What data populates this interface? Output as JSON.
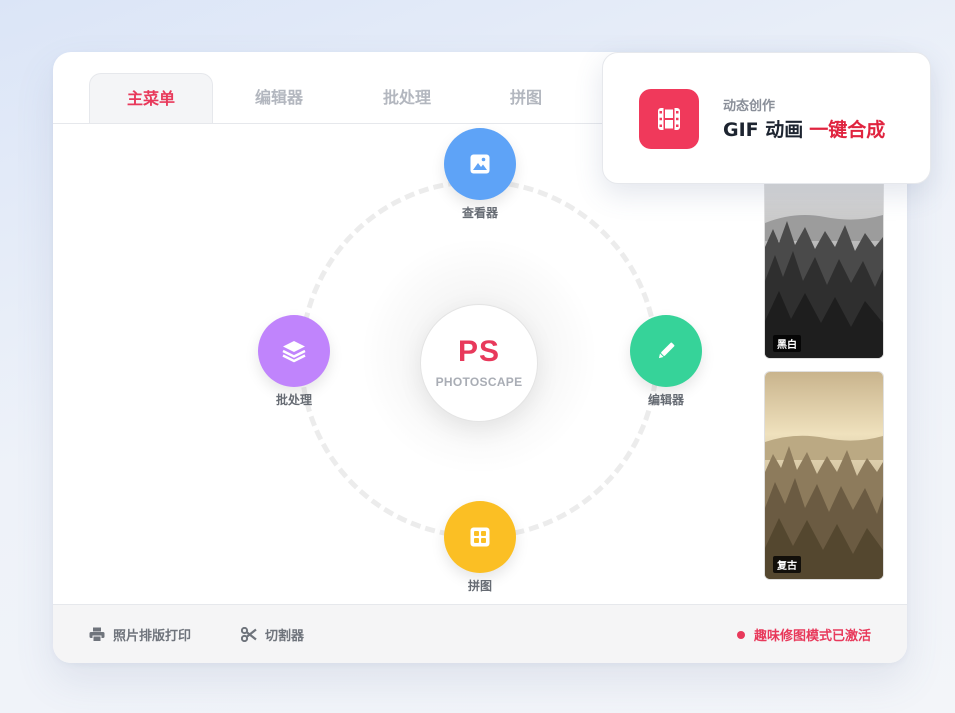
{
  "tabs": [
    {
      "label": "主菜单",
      "active": true
    },
    {
      "label": "编辑器",
      "active": false
    },
    {
      "label": "批处理",
      "active": false
    },
    {
      "label": "拼图",
      "active": false
    }
  ],
  "center": {
    "logo": "PS",
    "subtitle": "PHOTOSCAPE"
  },
  "nodes": {
    "viewer": {
      "label": "查看器",
      "icon": "image-icon",
      "color": "#5ea3f7"
    },
    "editor": {
      "label": "编辑器",
      "icon": "pencil-icon",
      "color": "#36d399"
    },
    "batch": {
      "label": "批处理",
      "icon": "layers-icon",
      "color": "#c084fc"
    },
    "collage": {
      "label": "拼图",
      "icon": "grid-icon",
      "color": "#fbbf24"
    }
  },
  "thumbnails": [
    {
      "label": "黑白"
    },
    {
      "label": "复古"
    }
  ],
  "footer": {
    "print_label": "照片排版打印",
    "cutter_label": "切割器",
    "status": "趣味修图模式已激活"
  },
  "popup": {
    "subtitle": "动态创作",
    "title": "GIF 动画",
    "highlight": "一键合成"
  },
  "colors": {
    "accent": "#e8395b",
    "popup_icon": "#f0395b"
  }
}
